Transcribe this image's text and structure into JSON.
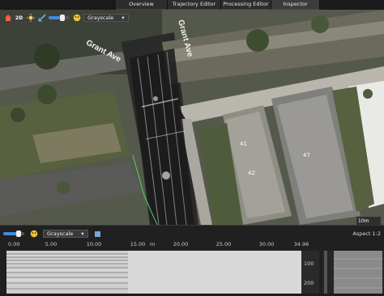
{
  "tabs": [
    {
      "label": "Overview",
      "active": false
    },
    {
      "label": "Trajectory Editor",
      "active": false
    },
    {
      "label": "Processing Editor",
      "active": false
    },
    {
      "label": "Inspector",
      "active": true
    }
  ],
  "map_toolbar": {
    "icons": [
      "home-icon",
      "2d-toggle-icon",
      "sun-icon",
      "measure-icon",
      "transparency-slider",
      "palette-icon"
    ],
    "view_mode": "2D",
    "colormap": "Grayscale"
  },
  "map": {
    "streets": [
      "Grant Ave",
      "Grant Ave"
    ],
    "scale_label": "10m",
    "house_numbers": [
      "41",
      "42",
      "47"
    ]
  },
  "bottom_toolbar": {
    "colormap": "Grayscale",
    "aspect_label": "Aspect 1:2"
  },
  "ruler": {
    "ticks": [
      "0.00",
      "5.00",
      "10.00",
      "15.00",
      "20.00",
      "25.00",
      "30.00",
      "34.96"
    ],
    "unit": "m"
  },
  "depth_axis": {
    "ticks": [
      "100",
      "200"
    ]
  },
  "colors": {
    "accent": "#3d8be0",
    "tab_bg": "#2d2d2d",
    "panel_bg": "#202020"
  }
}
